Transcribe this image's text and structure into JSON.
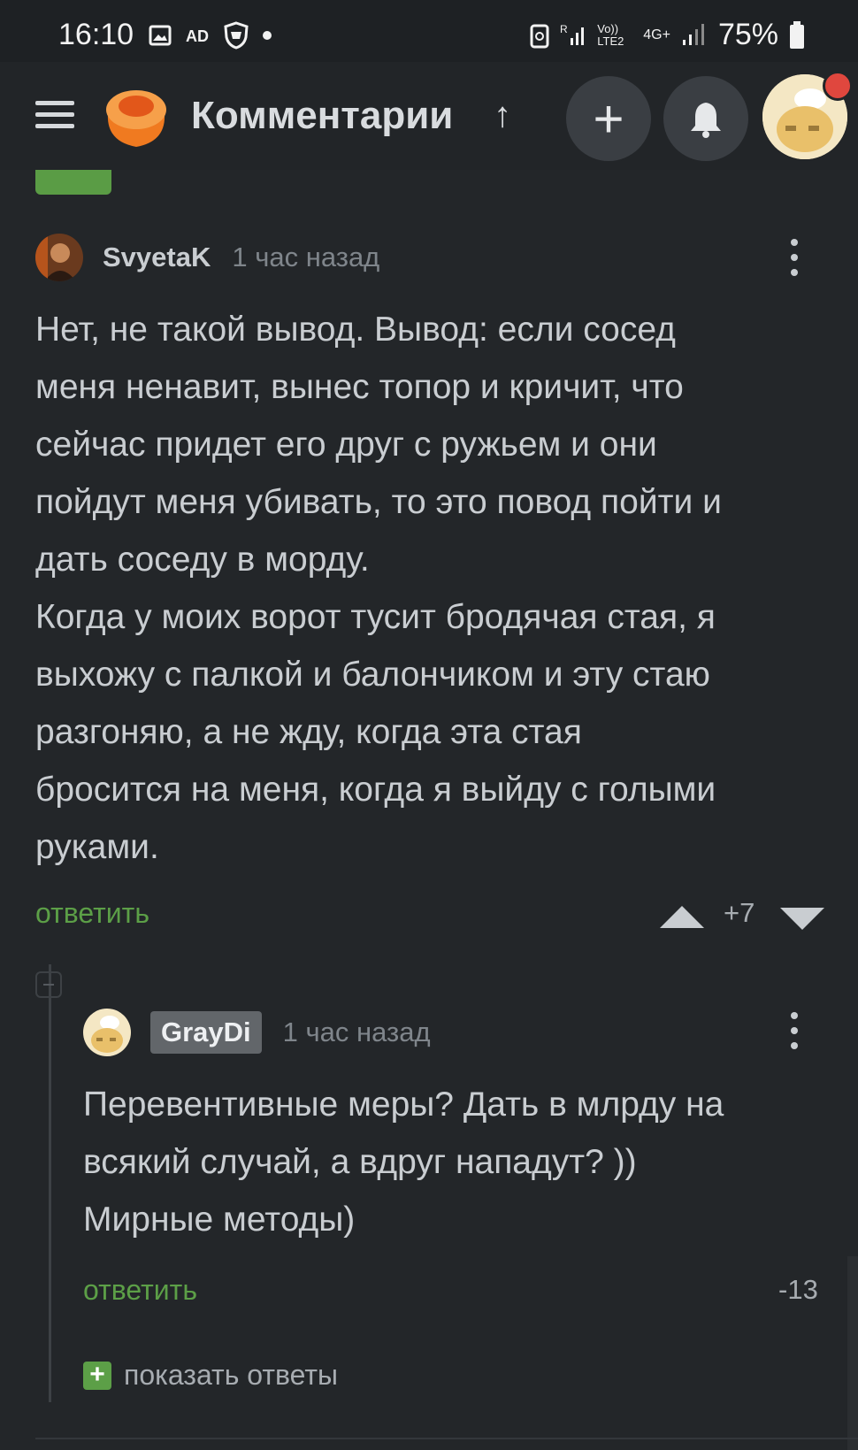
{
  "status_bar": {
    "time": "16:10",
    "network_label": "4G+",
    "volte_label": "Vo)) LTE2",
    "battery": "75%"
  },
  "app_bar": {
    "title": "Комментарии",
    "up_arrow": "↑",
    "add_label": "+"
  },
  "comments": [
    {
      "author": "SvyetaK",
      "time": "1 час назад",
      "text": "Нет, не такой вывод. Вывод: если сосед\nменя ненавит, вынес топор и кричит, что\nсейчас придет его друг с ружьем и они\nпойдут меня убивать, то это повод пойти и\nдать соседу в морду.\nКогда у моих ворот тусит бродячая стая, я\nвыхожу с палкой и балончиком и эту стаю\nразгоняю, а не жду, когда эта стая\nбросится на меня, когда я выйду с голыми\nруками.",
      "reply_label": "ответить",
      "rating": "+7"
    },
    {
      "author": "GrayDi",
      "time": "1 час назад",
      "text": "Перевентивные меры? Дать в млрду на\nвсякий случай, а вдруг нападут? ))\nМирные методы)",
      "reply_label": "ответить",
      "rating": "-13"
    }
  ],
  "show_replies": {
    "plus": "+",
    "label": "показать ответы"
  },
  "colors": {
    "background": "#232629",
    "accent_green": "#5c9f47",
    "notification_red": "#e0473e"
  }
}
